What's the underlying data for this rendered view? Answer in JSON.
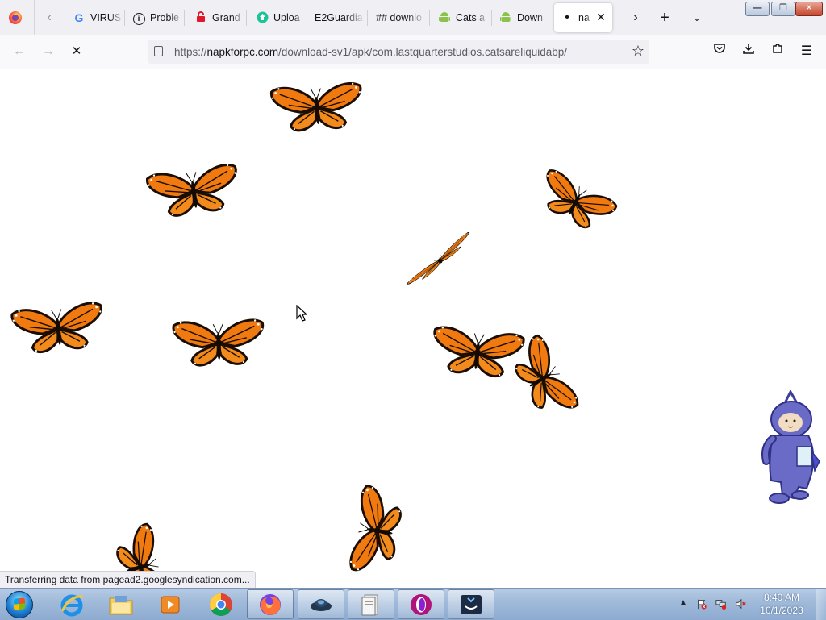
{
  "browser": {
    "tabs": [
      {
        "label": "VIRUS",
        "icon": "google-icon"
      },
      {
        "label": "Proble",
        "icon": "info-icon"
      },
      {
        "label": "Grand",
        "icon": "lock-icon"
      },
      {
        "label": "Uploa",
        "icon": "upload-icon"
      },
      {
        "label": "E2Guardia",
        "icon": ""
      },
      {
        "label": "## downlo",
        "icon": ""
      },
      {
        "label": "Cats a",
        "icon": "android-icon"
      },
      {
        "label": "Down",
        "icon": "android-icon"
      },
      {
        "label": "na",
        "icon": "loading-dot-icon",
        "active": true
      }
    ],
    "address": {
      "prefix": "https://",
      "domain": "napkforpc.com",
      "path": "/download-sv1/apk/com.lastquarterstudios.catsareliquidabp/"
    },
    "status_text": "Transferring data from pagead2.googlesyndication.com..."
  },
  "taskbar": {
    "apps": [
      "internet-explorer-icon",
      "file-explorer-icon",
      "media-player-icon",
      "chrome-icon",
      "firefox-icon",
      "game-app-icon",
      "files-app-icon",
      "opera-icon",
      "screen-tool-icon"
    ],
    "clock": {
      "time": "8:40 AM",
      "date": "10/1/2023"
    }
  },
  "colors": {
    "tabstrip": "#f0f0f4",
    "toolbar": "#f9f9fb",
    "butterfly_orange": "#f07a10",
    "taskbar": "#9fb9d9"
  }
}
